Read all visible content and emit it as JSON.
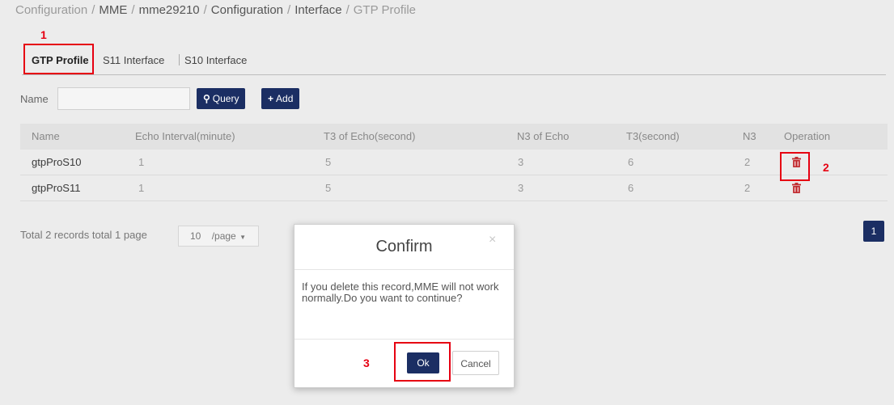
{
  "breadcrumb": [
    "Configuration",
    "MME",
    "mme29210",
    "Configuration",
    "Interface",
    "GTP Profile"
  ],
  "annotations": {
    "mark1": "1",
    "mark2": "2",
    "mark3": "3",
    "color": "#e60012"
  },
  "tabs": [
    {
      "label": "GTP Profile",
      "active": true
    },
    {
      "label": "S11 Interface",
      "active": false
    },
    {
      "label": "S10 Interface",
      "active": false
    }
  ],
  "search": {
    "label": "Name",
    "value": "",
    "placeholder": "",
    "query_label": "Query",
    "add_label": "Add"
  },
  "table": {
    "headers": [
      "Name",
      "Echo Interval(minute)",
      "T3 of Echo(second)",
      "N3 of Echo",
      "T3(second)",
      "N3",
      "Operation"
    ],
    "rows": [
      {
        "name": "gtpProS10",
        "echo_interval": "1",
        "t3_echo": "5",
        "n3_echo": "3",
        "t3": "6",
        "n3": "2",
        "operation_icon": "trash-icon"
      },
      {
        "name": "gtpProS11",
        "echo_interval": "1",
        "t3_echo": "5",
        "n3_echo": "3",
        "t3": "6",
        "n3": "2",
        "operation_icon": "trash-icon"
      }
    ]
  },
  "pagination": {
    "summary": "Total 2 records total 1  page",
    "page_size": "10",
    "page_size_suffix": "/page",
    "current_page": "1"
  },
  "modal": {
    "title": "Confirm",
    "close": "×",
    "message": "If you delete this record,MME will not work normally.Do you want to continue?",
    "ok_label": "Ok",
    "cancel_label": "Cancel"
  },
  "colors": {
    "accent": "#1b2e63",
    "danger": "#c0282d",
    "annotation": "#e60012"
  }
}
